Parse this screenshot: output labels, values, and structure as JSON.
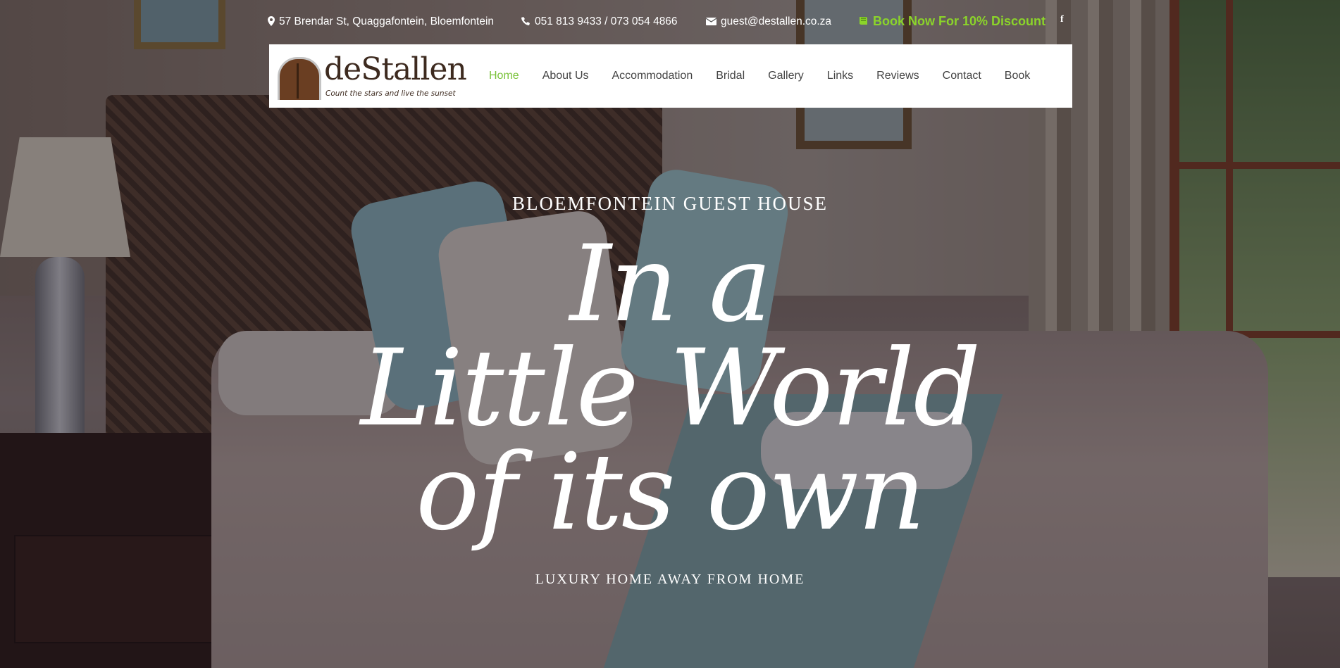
{
  "topbar": {
    "address": "57 Brendar St, Quaggafontein, Bloemfontein",
    "phone": "051 813 9433 / 073 054 4866",
    "email": "guest@destallen.co.za",
    "book_cta": "Book Now For 10% Discount",
    "facebook": "f",
    "icons": {
      "address": "map-marker-icon",
      "phone": "phone-icon",
      "email": "envelope-icon",
      "book": "book-icon"
    }
  },
  "logo": {
    "name_prefix": "de",
    "name_suffix": "Stallen",
    "tagline": "Count the stars and live the sunset"
  },
  "nav": {
    "items": [
      {
        "label": "Home",
        "active": true
      },
      {
        "label": "About Us"
      },
      {
        "label": "Accommodation"
      },
      {
        "label": "Bridal"
      },
      {
        "label": "Gallery"
      },
      {
        "label": "Links"
      },
      {
        "label": "Reviews"
      },
      {
        "label": "Contact"
      },
      {
        "label": "Book"
      }
    ]
  },
  "hero": {
    "eyebrow": "BLOEMFONTEIN GUEST HOUSE",
    "headline_lines": [
      "In a",
      "Little World",
      "of its own"
    ],
    "subline": "LUXURY HOME AWAY FROM HOME"
  },
  "colors": {
    "accent_green": "#7ac23a",
    "cta_green": "#8bd42a",
    "nav_text": "#444444"
  }
}
